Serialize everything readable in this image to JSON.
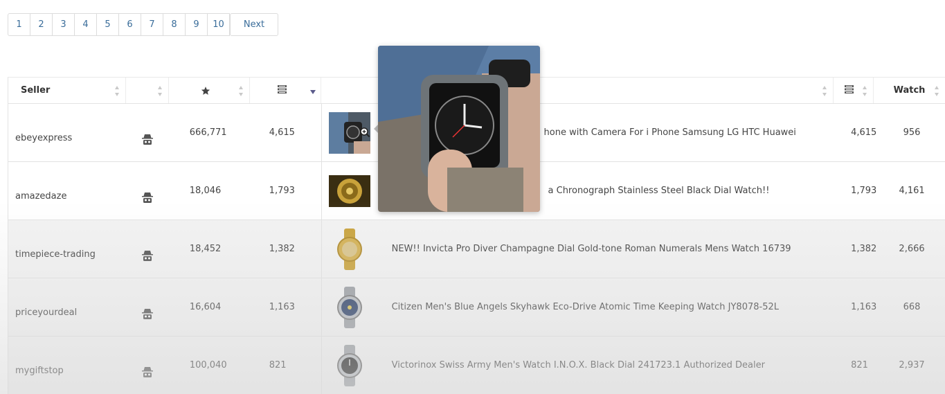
{
  "pagination": {
    "pages": [
      "1",
      "2",
      "3",
      "4",
      "5",
      "6",
      "7",
      "8",
      "9",
      "10"
    ],
    "next_label": "Next"
  },
  "table": {
    "headers": {
      "seller": "Seller",
      "watch": "Watch"
    },
    "rows": [
      {
        "seller": "ebeyexpress",
        "feedback": "666,771",
        "sold": "4,615",
        "title": "hone with Camera For i Phone Samsung LG HTC Huawei",
        "sold2": "4,615",
        "watch": "956"
      },
      {
        "seller": "amazedaze",
        "feedback": "18,046",
        "sold": "1,793",
        "title": "a Chronograph Stainless Steel Black Dial Watch!!",
        "sold2": "1,793",
        "watch": "4,161"
      },
      {
        "seller": "timepiece-trading",
        "feedback": "18,452",
        "sold": "1,382",
        "title": "NEW!! Invicta Pro Diver Champagne Dial Gold-tone Roman Numerals Mens Watch 16739",
        "sold2": "1,382",
        "watch": "2,666"
      },
      {
        "seller": "priceyourdeal",
        "feedback": "16,604",
        "sold": "1,163",
        "title": "Citizen Men's Blue Angels Skyhawk Eco-Drive Atomic Time Keeping Watch JY8078-52L",
        "sold2": "1,163",
        "watch": "668"
      },
      {
        "seller": "mygiftstop",
        "feedback": "100,040",
        "sold": "821",
        "title": "Victorinox Swiss Army Men's Watch I.N.O.X. Black Dial 241723.1 Authorized Dealer",
        "sold2": "821",
        "watch": "2,937"
      }
    ]
  },
  "colors": {
    "link": "#3a6d9a",
    "row_shade": "#f3f3f3",
    "sort_active": "#5a5a8a"
  }
}
